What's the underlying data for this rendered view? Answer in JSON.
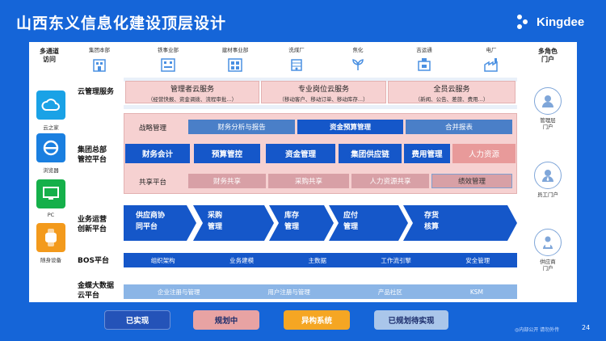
{
  "title": "山西东义信息化建设顶层设计",
  "logo_text": "Kingdee",
  "left_title": "多通道\n访问",
  "right_title": "多角色\n门户",
  "channels": [
    {
      "label": "云之家",
      "color": "#1aa2e6",
      "icon": "cloud-icon"
    },
    {
      "label": "浏览器",
      "color": "#1a7fe0",
      "icon": "ie-browser-icon"
    },
    {
      "label": "PC",
      "color": "#15b04a",
      "icon": "monitor-icon"
    },
    {
      "label": "随身设备",
      "color": "#f39a1c",
      "icon": "watch-icon"
    }
  ],
  "portals": [
    {
      "label": "管理层\n门户",
      "icon": "manager-icon"
    },
    {
      "label": "员工门户",
      "icon": "employee-icon"
    },
    {
      "label": "供应商\n门户",
      "icon": "supplier-icon"
    }
  ],
  "business_units": [
    {
      "label": "集团本部",
      "icon": "headquarters-icon"
    },
    {
      "label": "铁事业部",
      "icon": "iron-factory-icon"
    },
    {
      "label": "建材事业部",
      "icon": "building-icon"
    },
    {
      "label": "洗煤厂",
      "icon": "coal-plant-icon"
    },
    {
      "label": "焦化",
      "icon": "coking-icon"
    },
    {
      "label": "吉运通",
      "icon": "logistics-icon"
    },
    {
      "label": "电厂",
      "icon": "power-plant-icon"
    }
  ],
  "cloud": {
    "label": "云管理服务",
    "boxes": [
      {
        "title": "管理者云服务",
        "sub": "（经营快报、资金调拨、流程审批...）"
      },
      {
        "title": "专业岗位云服务",
        "sub": "（移动客户、移动订单、移动库存...）"
      },
      {
        "title": "全员云服务",
        "sub": "（新闻、公告、差旅、费用...）"
      }
    ]
  },
  "group": {
    "label": "集团总部\n管控平台",
    "strategy_label": "战略管理",
    "strategy": [
      "财务分析与报告",
      "资金预算管理",
      "合并报表"
    ],
    "core": [
      "财务会计",
      "预算管控",
      "资金管理",
      "集团供应链",
      "费用管理",
      "人力资源"
    ],
    "shared_label": "共享平台",
    "shared": [
      "财务共享",
      "采购共享",
      "人力资源共享",
      "绩效管理"
    ]
  },
  "ops": {
    "label": "业务运营\n创新平台",
    "arrows": [
      "供应商协\n同平台",
      "采购\n管理",
      "库存\n管理",
      "应付\n管理",
      "存货\n核算"
    ]
  },
  "bos": {
    "label": "BOS平台",
    "items": [
      "组织架构",
      "业务建模",
      "主数据",
      "工作流引擎",
      "安全管理"
    ]
  },
  "kd": {
    "label": "金蝶大数据\n云平台",
    "items": [
      "企业注册与管理",
      "用户注册与管理",
      "产品社区",
      "KSM"
    ]
  },
  "legend": [
    {
      "label": "已实现",
      "bg": "#2453b8",
      "fg": "#ffffff"
    },
    {
      "label": "规划中",
      "bg": "#e8a3a3",
      "fg": "#1b2c6b"
    },
    {
      "label": "异构系统",
      "bg": "#f5a623",
      "fg": "#ffffff"
    },
    {
      "label": "已规划待实现",
      "bg": "#aac6ea",
      "fg": "#1b2c6b"
    }
  ],
  "footer_note": "◎内部公开 请勿外传",
  "page_number": "24"
}
